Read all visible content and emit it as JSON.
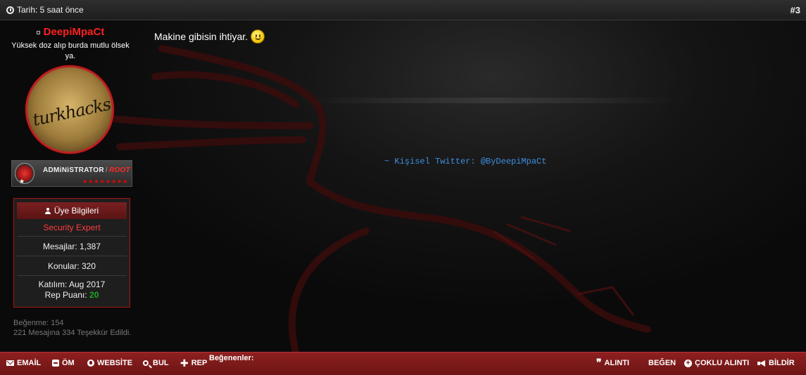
{
  "header": {
    "date_label": "Tarih: 5 saat önce",
    "post_number": "#3"
  },
  "user": {
    "username": "DeepiMpaCt",
    "user_title": "Yüksek doz alıp burda mutlu ölsek ya.",
    "avatar_text": "turkhacks.com",
    "rank": {
      "primary": "ADMiNiSTRATOR",
      "separator": "/",
      "secondary": "ROOT",
      "stars": "★★★★★★★★"
    },
    "info": {
      "header_label": "Üye Bilgileri",
      "role": "Security Expert",
      "posts": "Mesajlar: 1,387",
      "threads": "Konular: 320",
      "joined": "Katılım: Aug 2017",
      "rep_label": "Rep Puanı:",
      "rep_value": "20"
    },
    "likes_line": "Beğenme: 154",
    "thanks_line": "221 Mesajına 334 Teşekkür Edildi."
  },
  "post": {
    "message": "Makine gibisin ihtiyar.",
    "signature": "~ Kişisel Twitter: @ByDeepiMpaCt"
  },
  "footer": {
    "email": "EMAİL",
    "pm": "ÖM",
    "website": "WEBSİTE",
    "find": "BUL",
    "rep": "REP",
    "likers_label": "Beğenenler:",
    "quote": "ALINTI",
    "like": "BEĞEN",
    "multi_quote": "ÇOKLU ALINTI",
    "report": "BİLDİR"
  },
  "colors": {
    "accent_red": "#ff2020",
    "footer_red": "#7a1a1a",
    "signature_blue": "#3d8fe0",
    "rep_green": "#1ea81e"
  }
}
